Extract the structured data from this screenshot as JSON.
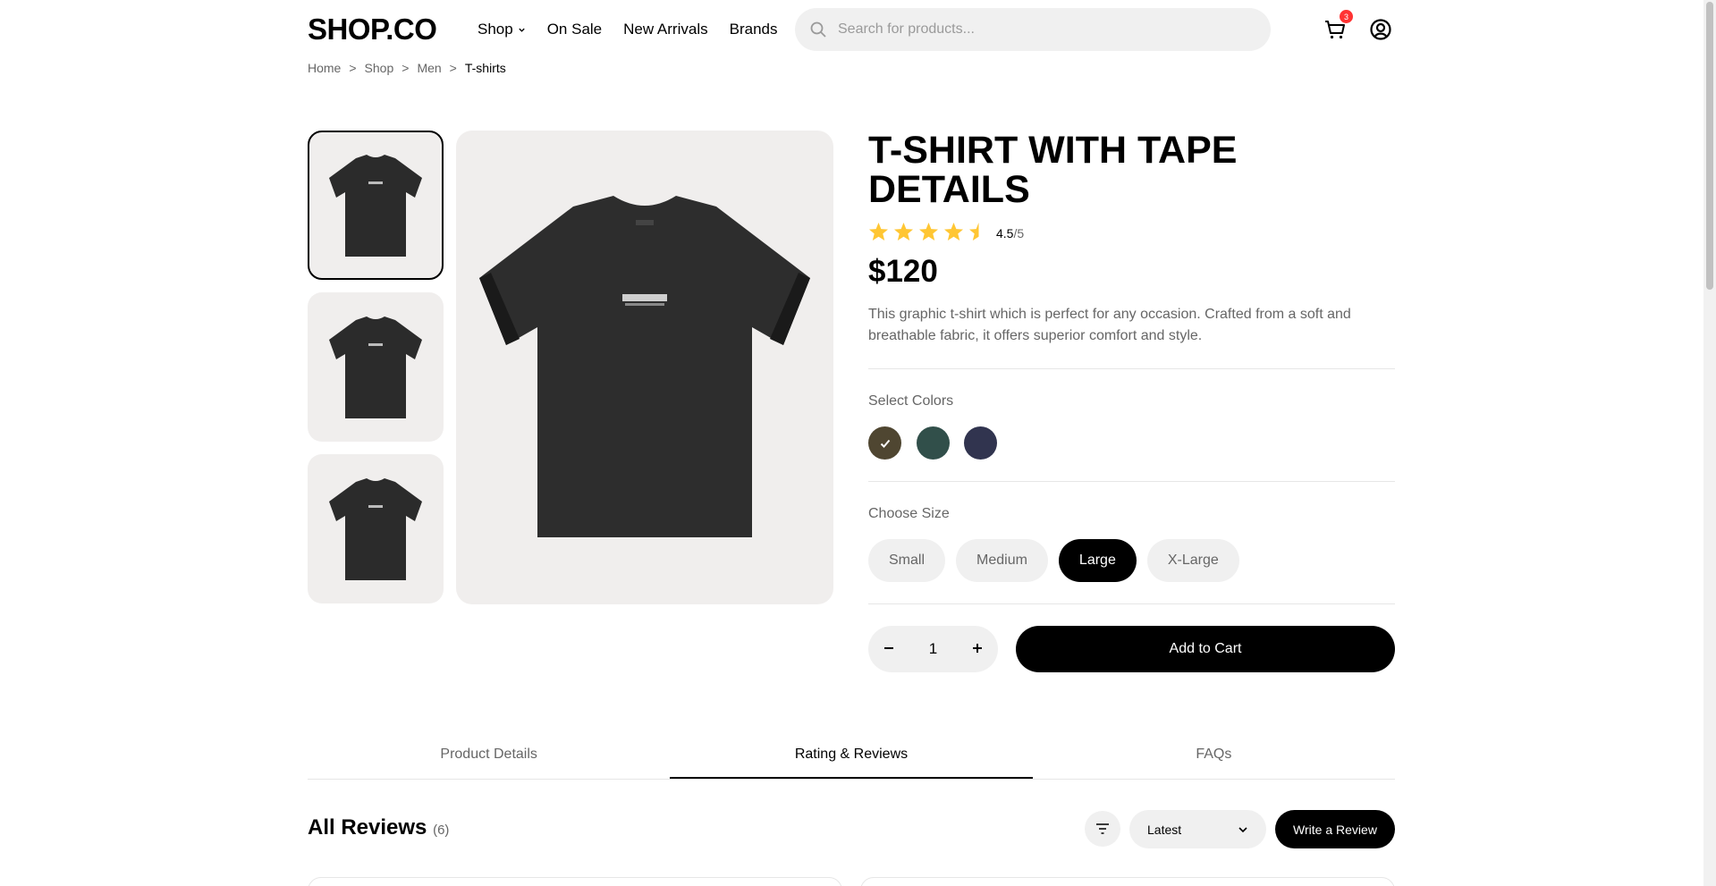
{
  "header": {
    "logo": "SHOP.CO",
    "menu": [
      "Shop",
      "On Sale",
      "New Arrivals",
      "Brands"
    ],
    "search_placeholder": "Search for products...",
    "cart_count": "3"
  },
  "breadcrumb": [
    "Home",
    ">",
    "Shop",
    ">",
    "Men",
    ">",
    "T-shirts"
  ],
  "product": {
    "title": "T-shirt with Tape Details",
    "rating": "4.5",
    "rating_max": "/5",
    "rating_value": 4.5,
    "price": "$120",
    "description": "This graphic t-shirt which is perfect for any occasion. Crafted from a soft and breathable fabric, it offers superior comfort and style.",
    "colors_label": "Select Colors",
    "colors": [
      "#4f4631",
      "#314f4a",
      "#31344f"
    ],
    "size_label": "Choose Size",
    "sizes": [
      "Small",
      "Medium",
      "Large",
      "X-Large"
    ],
    "selected_size": "Large",
    "quantity": "1",
    "add_to_cart": "Add to Cart"
  },
  "tabs": [
    "Product Details",
    "Rating & Reviews",
    "FAQs"
  ],
  "reviews": {
    "title": "All Reviews",
    "count": "(6)",
    "sort": "Latest",
    "write": "Write a Review"
  }
}
